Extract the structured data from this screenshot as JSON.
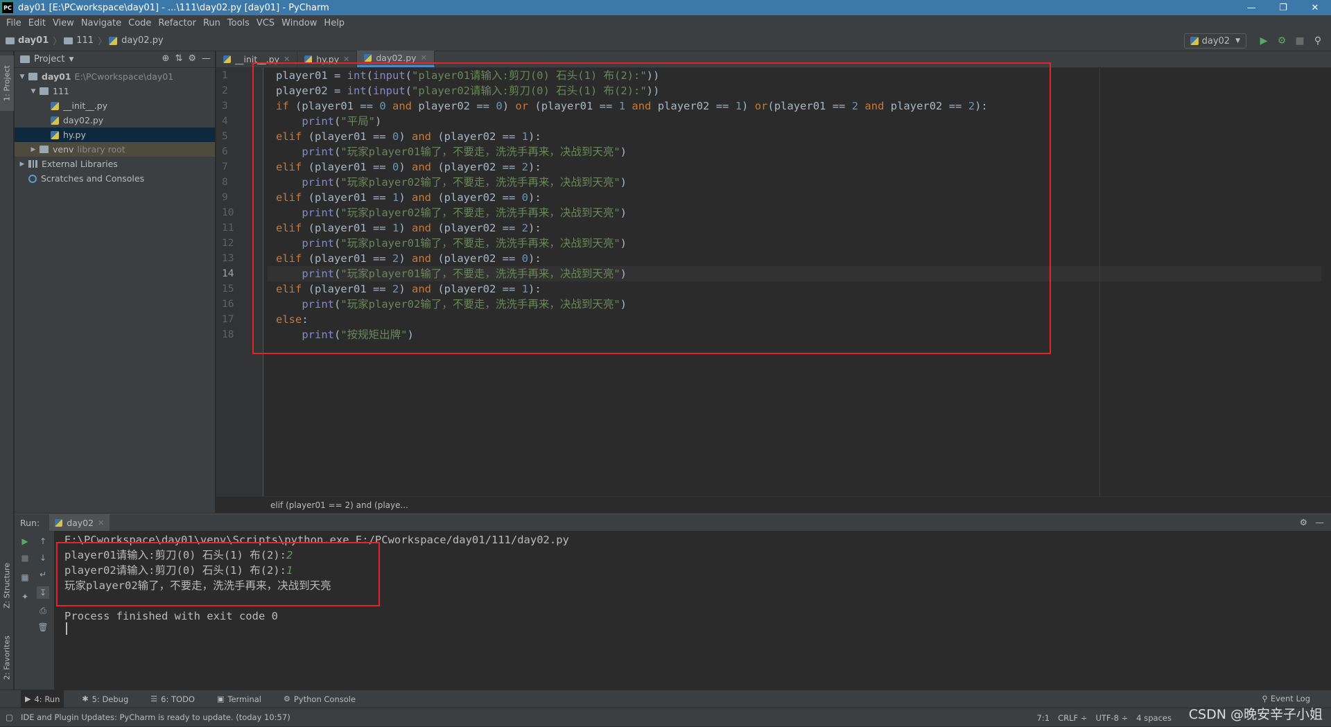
{
  "window": {
    "title": "day01 [E:\\PCworkspace\\day01] - ...\\111\\day02.py [day01] - PyCharm",
    "logo": "PC"
  },
  "menu": [
    "File",
    "Edit",
    "View",
    "Navigate",
    "Code",
    "Refactor",
    "Run",
    "Tools",
    "VCS",
    "Window",
    "Help"
  ],
  "breadcrumb": [
    "day01",
    "111",
    "day02.py"
  ],
  "run_config": {
    "label": "day02"
  },
  "project": {
    "header": "Project",
    "tree": [
      {
        "label": "day01",
        "extra": "E:\\PCworkspace\\day01",
        "level": 0,
        "type": "folder",
        "open": true
      },
      {
        "label": "111",
        "level": 1,
        "type": "folder",
        "open": true
      },
      {
        "label": "__init__.py",
        "level": 2,
        "type": "py"
      },
      {
        "label": "day02.py",
        "level": 2,
        "type": "py"
      },
      {
        "label": "hy.py",
        "level": 2,
        "type": "py",
        "selected": true
      },
      {
        "label": "venv",
        "extra": "library root",
        "level": 1,
        "type": "folder",
        "open": false
      },
      {
        "label": "External Libraries",
        "level": 0,
        "type": "lib",
        "open": false
      },
      {
        "label": "Scratches and Consoles",
        "level": 0,
        "type": "scratch"
      }
    ]
  },
  "side_tabs": {
    "project": "1: Project",
    "structure": "Z: Structure",
    "favorites": "2: Favorites"
  },
  "editor_tabs": [
    {
      "label": "__init__.py",
      "active": false
    },
    {
      "label": "hy.py",
      "active": false
    },
    {
      "label": "day02.py",
      "active": true
    }
  ],
  "code_lines": [
    "player01 = int(input(\"player01请输入:剪刀(0) 石头(1) 布(2):\"))",
    "player02 = int(input(\"player02请输入:剪刀(0) 石头(1) 布(2):\"))",
    "if (player01 == 0 and player02 == 0) or (player01 == 1 and player02 == 1) or(player01 == 2 and player02 == 2):",
    "    print(\"平局\")",
    "elif (player01 == 0) and (player02 == 1):",
    "    print(\"玩家player01输了，不要走，洗洗手再来，决战到天亮\")",
    "elif (player01 == 0) and (player02 == 2):",
    "    print(\"玩家player02输了，不要走，洗洗手再来，决战到天亮\")",
    "elif (player01 == 1) and (player02 == 0):",
    "    print(\"玩家player02输了，不要走，洗洗手再来，决战到天亮\")",
    "elif (player01 == 1) and (player02 == 2):",
    "    print(\"玩家player01输了，不要走，洗洗手再来，决战到天亮\")",
    "elif (player01 == 2) and (player02 == 0):",
    "    print(\"玩家player01输了，不要走，洗洗手再来，决战到天亮\")",
    "elif (player01 == 2) and (player02 == 1):",
    "    print(\"玩家player02输了，不要走，洗洗手再来，决战到天亮\")",
    "else:",
    "    print(\"按规矩出牌\")"
  ],
  "current_line": 14,
  "editor_breadcrumb": "elif (player01 == 2) and (playe...",
  "run": {
    "label": "Run:",
    "tab": "day02",
    "console": {
      "command": "E:\\PCworkspace\\day01\\venv\\Scripts\\python.exe E:/PCworkspace/day01/111/day02.py",
      "prompt1": "player01请输入:剪刀(0) 石头(1) 布(2):",
      "input1": "2",
      "prompt2": "player02请输入:剪刀(0) 石头(1) 布(2):",
      "input2": "1",
      "result": "玩家player02输了，不要走，洗洗手再来，决战到天亮",
      "exit": "Process finished with exit code 0"
    }
  },
  "bottom_tabs": [
    {
      "label": "4: Run",
      "icon": "run-icon",
      "active": true
    },
    {
      "label": "5: Debug",
      "icon": "bug-icon",
      "active": false
    },
    {
      "label": "6: TODO",
      "icon": "list-icon",
      "active": false
    },
    {
      "label": "Terminal",
      "icon": "terminal-icon",
      "active": false
    },
    {
      "label": "Python Console",
      "icon": "python-icon",
      "active": false
    }
  ],
  "event_log": "Event Log",
  "status": {
    "message": "IDE and Plugin Updates: PyCharm is ready to update. (today 10:57)",
    "position": "7:1",
    "line_sep": "CRLF ÷",
    "encoding": "UTF-8 ÷",
    "indent": "4 spaces"
  },
  "watermark": "CSDN @晚安辛子小姐",
  "colors": {
    "keyword": "#cc7832",
    "builtin": "#8888c6",
    "number": "#6897bb",
    "string": "#6a8759",
    "highlight_box": "#e5252a",
    "titlebar": "#3c78a8"
  }
}
